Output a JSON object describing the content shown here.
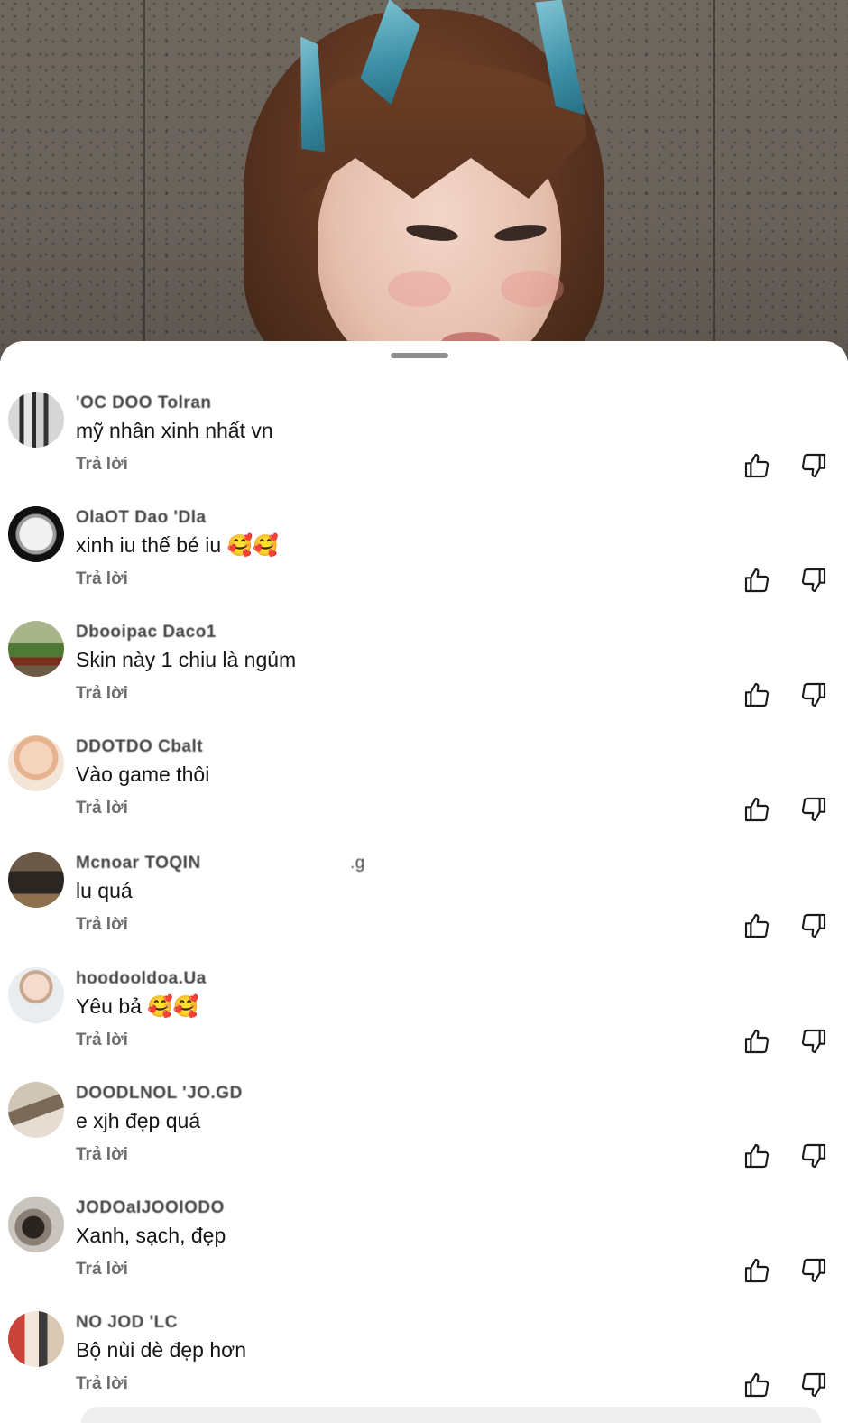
{
  "video": {
    "description_icon": "video-frame"
  },
  "comments": [
    {
      "username": "'OC DOO Tolran",
      "text": "mỹ nhân xinh nhất vn",
      "reply_label": "Trả lời",
      "avatar_icon": "avatar"
    },
    {
      "username": "OlaOT Dao 'Dla",
      "text": "xinh iu thế bé iu 🥰🥰",
      "reply_label": "Trả lời",
      "avatar_icon": "avatar"
    },
    {
      "username": "Dbooipac Daco1",
      "text": "Skin này 1 chiu là ngủm",
      "reply_label": "Trả lời",
      "avatar_icon": "avatar"
    },
    {
      "username": "DDOTDO Cbalt",
      "text": "Vào game thôi",
      "reply_label": "Trả lời",
      "avatar_icon": "avatar"
    },
    {
      "username": "Mcnoar TOQIN",
      "username_suffix": ".g",
      "text": "lu quá",
      "reply_label": "Trả lời",
      "avatar_icon": "avatar"
    },
    {
      "username": "hoodooldoa.Ua",
      "text": "Yêu bả 🥰🥰",
      "reply_label": "Trả lời",
      "avatar_icon": "avatar"
    },
    {
      "username": "DOODLNOL 'JO.GD",
      "text": "e xjh đẹp quá",
      "reply_label": "Trả lời",
      "avatar_icon": "avatar"
    },
    {
      "username": "JODOaIJOOIODO",
      "text": "Xanh, sạch, đẹp",
      "reply_label": "Trả lời",
      "avatar_icon": "avatar"
    },
    {
      "username": "NO JOD 'LC",
      "text": "Bộ nùi dè đẹp hơn",
      "reply_label": "Trả lời",
      "avatar_icon": "avatar"
    }
  ],
  "icons": {
    "like": "thumbs-up-icon",
    "dislike": "thumbs-down-icon"
  }
}
